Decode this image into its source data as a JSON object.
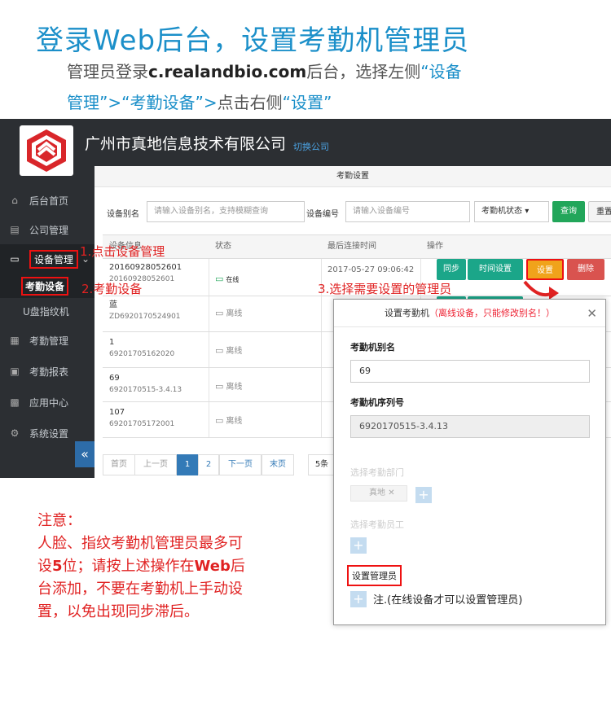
{
  "header": {
    "title": "登录Web后台，设置考勤机管理员",
    "line1_prefix": "管理员登录",
    "line1_url": "c.realandbio.com",
    "line1_mid": "后台，选择左侧",
    "line1_q1": "“设备",
    "line2_q1": "管理”>“考勤设备”>",
    "line2_mid": "点击右侧",
    "line2_q2": "“设置”"
  },
  "app": {
    "company": "广州市真地信息技术有限公司",
    "switch_label": "切换公司",
    "tab_label": "考勤设备",
    "panel_title": "考勤设置"
  },
  "sidebar": {
    "items": [
      {
        "label": "后台首页",
        "icon": "home-icon",
        "glyph": "⌂"
      },
      {
        "label": "公司管理",
        "icon": "building-icon",
        "glyph": "▤"
      },
      {
        "label": "设备管理",
        "icon": "monitor-icon",
        "glyph": "▭"
      },
      {
        "label": "考勤设备",
        "icon": "",
        "glyph": ""
      },
      {
        "label": "U盘指纹机",
        "icon": "",
        "glyph": ""
      },
      {
        "label": "考勤管理",
        "icon": "calendar-icon",
        "glyph": "▦"
      },
      {
        "label": "考勤报表",
        "icon": "report-icon",
        "glyph": "▣"
      },
      {
        "label": "应用中心",
        "icon": "apps-icon",
        "glyph": "▩"
      },
      {
        "label": "系统设置",
        "icon": "gear-icon",
        "glyph": "⚙"
      }
    ],
    "collapse_glyph": "«",
    "expand_glyph": "⌄"
  },
  "filters": {
    "alias_label": "设备别名",
    "alias_placeholder": "请输入设备别名，支持模糊查询",
    "serial_label": "设备编号",
    "serial_placeholder": "请输入设备编号",
    "status_select": "考勤机状态",
    "status_caret": "▾",
    "query_button": "查询",
    "reset_button": "重置"
  },
  "table": {
    "headers": [
      "设备信息",
      "状态",
      "最后连接时间",
      "操作"
    ],
    "rows": [
      {
        "name": "20160928052601",
        "sn": "20160928052601",
        "status": "在线",
        "online": true,
        "time": "2017-05-27 09:06:42"
      },
      {
        "name": "蓝",
        "sn": "ZD6920170524901",
        "status": "离线",
        "online": false,
        "time": ""
      },
      {
        "name": "1",
        "sn": "69201705162020",
        "status": "离线",
        "online": false,
        "time": ""
      },
      {
        "name": "69",
        "sn": "6920170515-3.4.13",
        "status": "离线",
        "online": false,
        "time": ""
      },
      {
        "name": "107",
        "sn": "69201705172001",
        "status": "离线",
        "online": false,
        "time": ""
      }
    ],
    "actions": {
      "sync": "同步",
      "time": "时间设置",
      "settings": "设置",
      "delete": "删除"
    }
  },
  "pager": {
    "first": "首页",
    "prev": "上一页",
    "p1": "1",
    "p2": "2",
    "next": "下一页",
    "last": "末页",
    "size": "5条"
  },
  "annotations": {
    "step1": "1.点击设备管理",
    "step2": "2.考勤设备",
    "step3": "3.选择需要设置的管理员"
  },
  "modal": {
    "title": "设置考勤机",
    "warning": "（离线设备，只能修改别名！）",
    "close": "✕",
    "alias_label": "考勤机别名",
    "alias_value": "69",
    "serial_label": "考勤机序列号",
    "serial_value": "6920170515-3.4.13",
    "dept_label": "选择考勤部门",
    "dept_tag": "真地",
    "dept_tag_x": "✕",
    "emp_label": "选择考勤员工",
    "admin_label": "设置管理员",
    "plus": "+",
    "note": "注.(在线设备才可以设置管理员)"
  },
  "notice": {
    "title": "注意：",
    "l1": "人脸、指纹考勤机管理员最多可",
    "l2a": "设",
    "l2b": "5",
    "l2c": "位；请按上述操作在",
    "l2d": "Web",
    "l2e": "后",
    "l3": "台添加，不要在考勤机上手动设",
    "l4": "置，以免出现同步滞后。"
  },
  "colors": {
    "accent": "#1b8fc9",
    "alert": "#e02222",
    "sidebar": "#2c2f33",
    "green": "#22a65a"
  }
}
